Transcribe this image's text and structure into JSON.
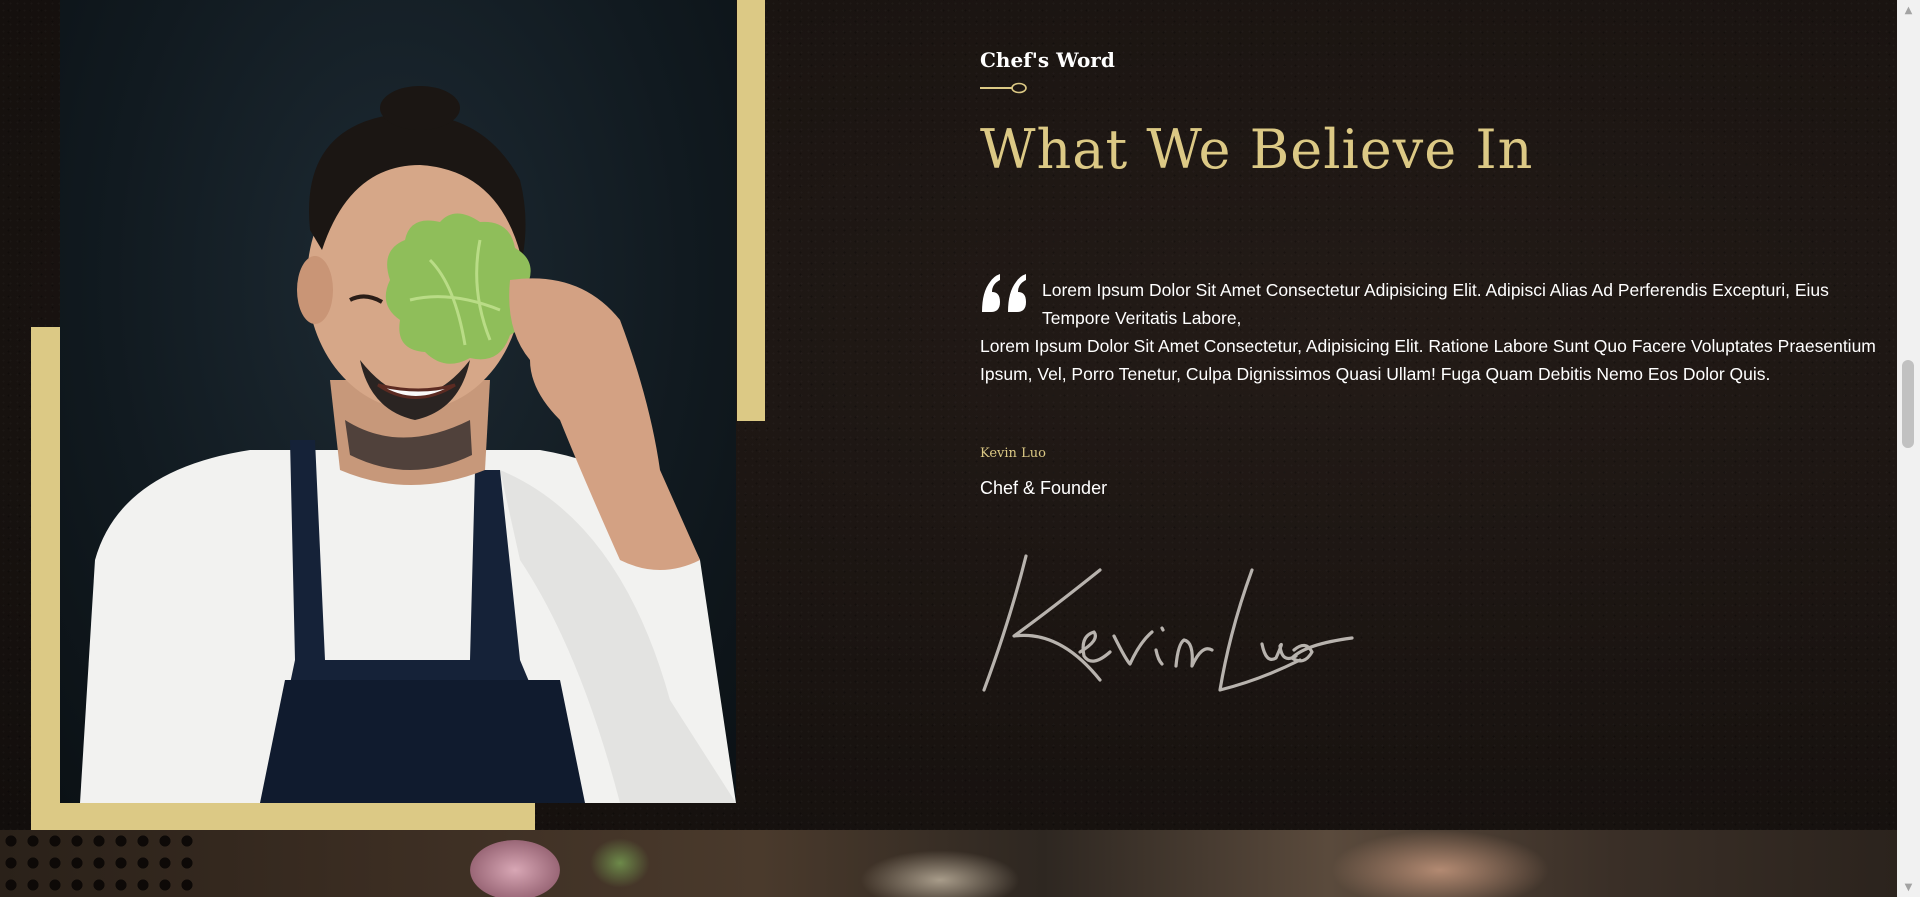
{
  "chef_section": {
    "eyebrow": "Chef's Word",
    "headline": "What We Believe In",
    "quote_line1": "Lorem Ipsum Dolor Sit Amet Consectetur Adipisicing Elit. Adipisci Alias Ad Perferendis Excepturi, Eius Tempore Veritatis Labore,",
    "quote_line2": "Lorem Ipsum Dolor Sit Amet Consectetur, Adipisicing Elit. Ratione Labore Sunt Quo Facere Voluptates Praesentium Ipsum, Vel, Porro Tenetur, Culpa Dignissimos Quasi Ullam! Fuga Quam Debitis Nemo Eos Dolor Quis.",
    "author_name": "Kevin Luo",
    "author_role": "Chef & Founder",
    "signature": "Kevin Luo"
  },
  "colors": {
    "accent_gold": "#dcc985",
    "background": "#1a1512",
    "text": "#ffffff"
  },
  "icons": {
    "quote": "quote-icon",
    "divider": "spoon-icon",
    "scroll_up": "scroll-up-arrow-icon",
    "scroll_down": "scroll-down-arrow-icon"
  }
}
